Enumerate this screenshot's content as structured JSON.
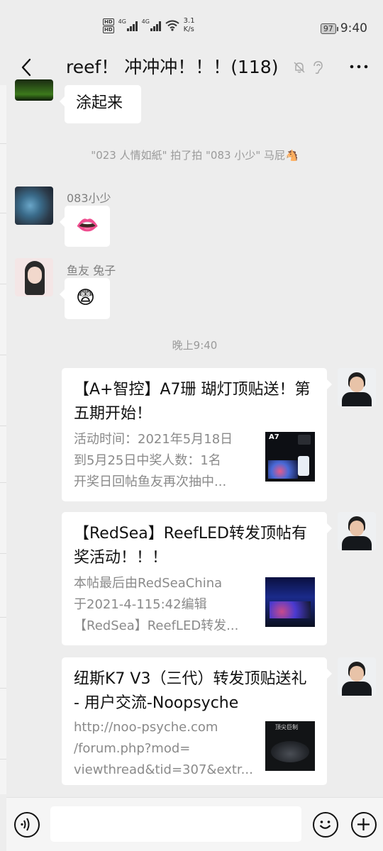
{
  "status_bar": {
    "hd1": "HD",
    "hd2": "HD",
    "net1": "4G",
    "net2": "4G",
    "speed_value": "3.1",
    "speed_unit": "K/s",
    "battery": "97",
    "time": "9:40"
  },
  "header": {
    "title": "reef！ 冲冲冲！！！(118)"
  },
  "messages": {
    "m1_text": "涂起来",
    "system_pat": "\"023 人情如紙\" 拍了拍 \"083 小少\" 马屁🐴",
    "m2_sender": "083小少",
    "m2_emoji": "👄",
    "m3_sender": "鱼友 兔子",
    "m3_emoji": "😨",
    "timestamp": "晚上9:40"
  },
  "links": [
    {
      "title": "【A+智控】A7珊 瑚灯顶贴送！第五期开始！",
      "desc": [
        "活动时间：2021年5月18日",
        "到5月25日中奖人数：1名",
        "开奖日回帖鱼友再次抽中..."
      ],
      "thumb_label": "A7"
    },
    {
      "title": "【RedSea】ReefLED转发顶帖有奖活动！！！",
      "desc": [
        "本帖最后由RedSeaChina",
        "于2021-4-115:42编辑",
        "【RedSea】ReefLED转发..."
      ]
    },
    {
      "title": "纽斯K7 V3（三代）转发顶贴送礼 - 用户交流-Noopsyche",
      "desc": [
        "http://noo-psyche.com",
        "/forum.php?mod=",
        "viewthread&tid=307&extr..."
      ],
      "thumb_label": "顶尖巨制"
    }
  ],
  "icons": {
    "back": "chevron-left-icon",
    "mute": "bell-off-icon",
    "ear": "ear-icon",
    "more": "more-icon",
    "voice": "voice-icon",
    "emoji": "emoji-icon",
    "plus": "plus-icon"
  },
  "colors": {
    "background": "#ededed",
    "bubble": "#ffffff",
    "muted_text": "#8a8a8a"
  }
}
